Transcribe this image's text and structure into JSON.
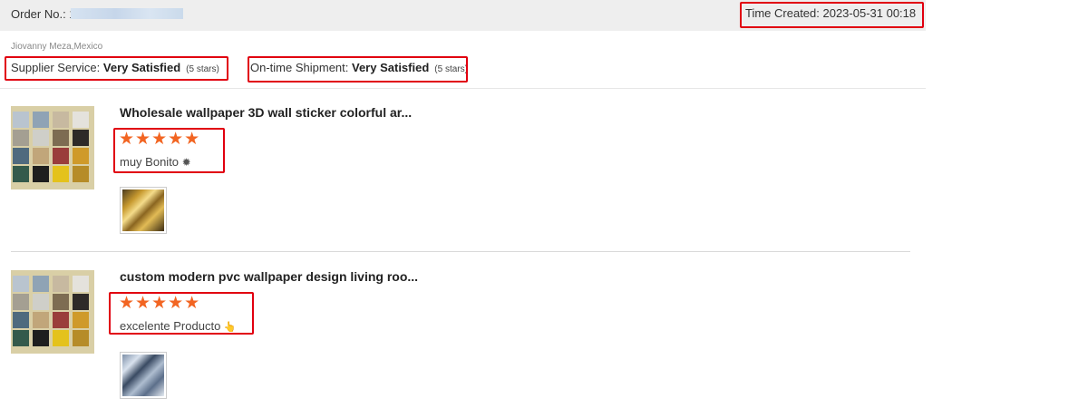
{
  "header": {
    "order_label": "Order No.: 1",
    "time_created": "Time Created: 2023-05-31 00:18"
  },
  "reviewer": "Jiovanny Meza,Mexico",
  "ratings": {
    "supplier": {
      "label": "Supplier Service: ",
      "value": "Very Satisfied",
      "note": "(5 stars)"
    },
    "shipment": {
      "label": "On-time Shipment: ",
      "value": "Very Satisfied",
      "note": "(5 stars)"
    }
  },
  "reviews": [
    {
      "title": "Wholesale wallpaper 3D wall sticker colorful ar...",
      "stars_text": "★★★★★",
      "rating": 5,
      "text": "muy Bonito",
      "emoji": "✹"
    },
    {
      "title": "custom modern pvc wallpaper design living roo...",
      "stars_text": "★★★★★",
      "rating": 5,
      "text": "excelente Producto",
      "emoji": "👆"
    }
  ],
  "colors": {
    "star": "#f26522",
    "highlight_box": "#e1000f",
    "header_bg": "#eeeeee"
  }
}
